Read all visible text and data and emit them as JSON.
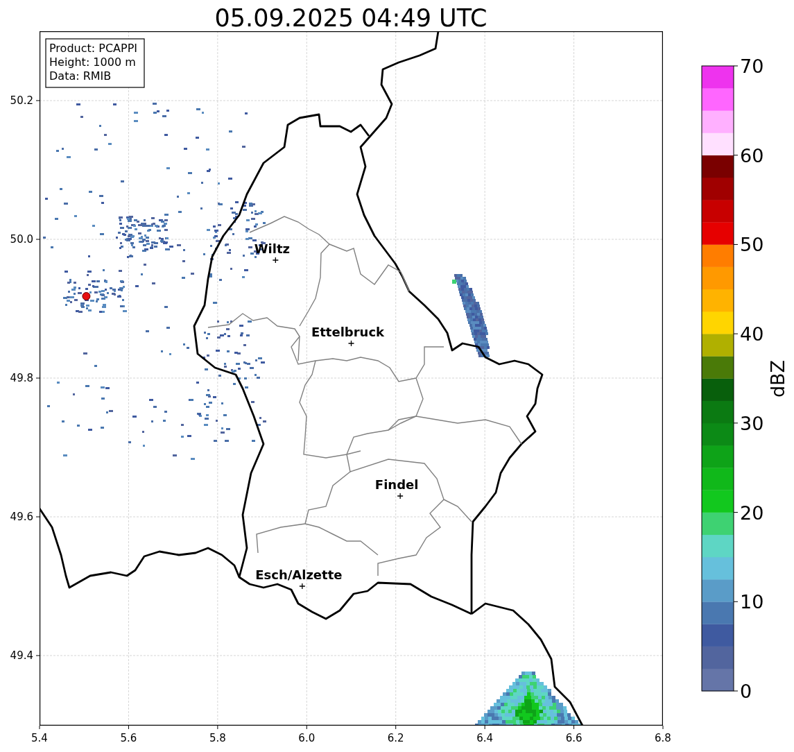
{
  "title": "05.09.2025 04:49 UTC",
  "legend": [
    "Product: PCAPPI",
    "Height: 1000 m",
    "Data: RMIB"
  ],
  "cities": [
    {
      "name": "Wiltz"
    },
    {
      "name": "Ettelbruck"
    },
    {
      "name": "Findel"
    },
    {
      "name": "Esch/Alzette"
    }
  ],
  "xaxis": {
    "ticks": [
      "5.4",
      "5.6",
      "5.8",
      "6.0",
      "6.2",
      "6.4",
      "6.6",
      "6.8"
    ]
  },
  "yaxis": {
    "ticks": [
      "50.2",
      "50.0",
      "49.8",
      "49.6",
      "49.4"
    ]
  },
  "colorbar": {
    "label": "dBZ",
    "ticks": [
      "70",
      "60",
      "50",
      "40",
      "30",
      "20",
      "10",
      "0"
    ],
    "bins": [
      {
        "color": "#6575a8"
      },
      {
        "color": "#52659e"
      },
      {
        "color": "#3f5aa0"
      },
      {
        "color": "#4a78b0"
      },
      {
        "color": "#5a9cc8"
      },
      {
        "color": "#66c0dc"
      },
      {
        "color": "#5ed6c4"
      },
      {
        "color": "#3ed272"
      },
      {
        "color": "#12c81e"
      },
      {
        "color": "#10b81a"
      },
      {
        "color": "#0ea318"
      },
      {
        "color": "#0c8a16"
      },
      {
        "color": "#0b7a12"
      },
      {
        "color": "#085f0c"
      },
      {
        "color": "#4a7a08"
      },
      {
        "color": "#b0b000"
      },
      {
        "color": "#ffd500"
      },
      {
        "color": "#ffb300"
      },
      {
        "color": "#ff9900"
      },
      {
        "color": "#ff7d00"
      },
      {
        "color": "#e60000"
      },
      {
        "color": "#c80000"
      },
      {
        "color": "#a00000"
      },
      {
        "color": "#7a0000"
      },
      {
        "color": "#ffe0ff"
      },
      {
        "color": "#ffb0ff"
      },
      {
        "color": "#ff66ff"
      },
      {
        "color": "#ee33ee"
      }
    ]
  }
}
